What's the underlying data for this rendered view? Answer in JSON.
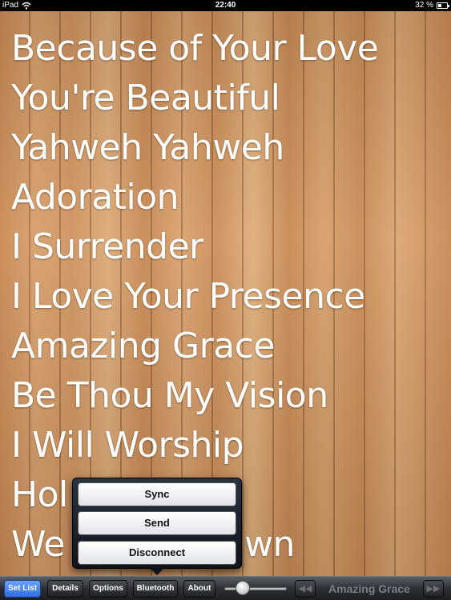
{
  "status_bar": {
    "carrier": "iPad",
    "time": "22:40",
    "battery": "32 %"
  },
  "songs": [
    "Because of Your Love",
    "You're Beautiful",
    "Yahweh Yahweh",
    "Adoration",
    "I Surrender",
    "I Love Your Presence",
    "Amazing Grace",
    "Be Thou My Vision",
    "I Will Worship",
    "Hol",
    "We",
    "wn"
  ],
  "popover": {
    "items": [
      "Sync",
      "Send",
      "Disconnect"
    ]
  },
  "toolbar": {
    "buttons": [
      "Set List",
      "Details",
      "Options",
      "Bluetooth",
      "About"
    ],
    "active": "Set List",
    "now_playing": "Amazing Grace",
    "prev_icon": "previous-icon",
    "next_icon": "next-icon"
  }
}
